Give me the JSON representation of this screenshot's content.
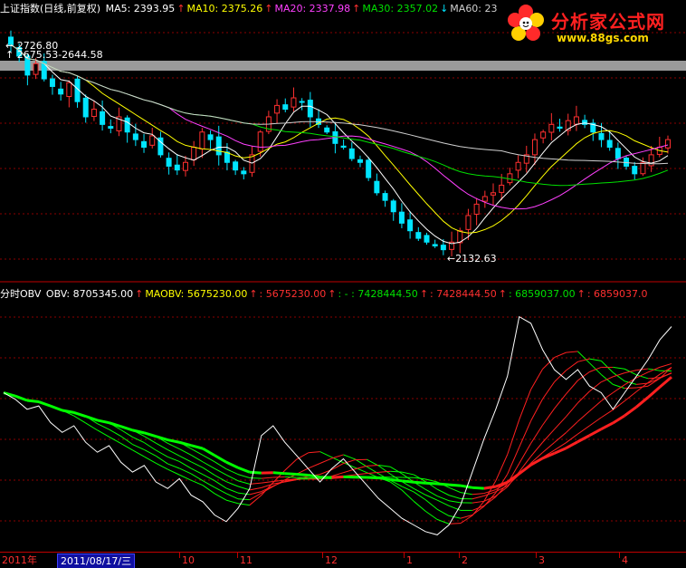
{
  "kline_header": {
    "title": "上证指数(日线,前复权)",
    "items": [
      {
        "label": "MA5: 2393.95",
        "arrow": "↑",
        "color": "#ffffff"
      },
      {
        "label": "MA10: 2375.26",
        "arrow": "↑",
        "color": "#ffff00"
      },
      {
        "label": "MA20: 2337.98",
        "arrow": "↑",
        "color": "#ff40ff"
      },
      {
        "label": "MA30: 2357.02",
        "arrow": "↓",
        "color": "#00e000"
      },
      {
        "label": "MA60: 23",
        "arrow": "",
        "color": "#d0d0d0"
      }
    ]
  },
  "obv_header": {
    "title": "分时OBV",
    "items": [
      {
        "label": "OBV: 8705345.00",
        "arrow": "↑",
        "color": "#ffffff"
      },
      {
        "label": "MAOBV: 5675230.00",
        "arrow": "↑",
        "color": "#ffff00"
      },
      {
        "label": ": 5675230.00",
        "arrow": "↑",
        "color": "#ff3030"
      },
      {
        "label": ": - : 7428444.50",
        "arrow": "↑",
        "color": "#00e000"
      },
      {
        "label": ": 7428444.50",
        "arrow": "↑",
        "color": "#ff3030"
      },
      {
        "label": ": 6859037.00",
        "arrow": "↑",
        "color": "#00e000"
      },
      {
        "label": ": 6859037.0",
        "arrow": "",
        "color": "#ff3030"
      }
    ]
  },
  "watermark": {
    "title": "分析家公式网",
    "url": "www.88gs.com"
  },
  "annotations": {
    "high_label": "2726.80",
    "range_label": "2675.53-2644.58",
    "low_label": "←2132.63"
  },
  "x_axis": {
    "year_label": "2011年",
    "selected_date": "2011/08/17/三",
    "months": [
      "10",
      "11",
      "12",
      "1",
      "2",
      "3",
      "4"
    ]
  },
  "colors": {
    "up": "#ff3030",
    "down": "#00e5ff",
    "ma5": "#ffffff",
    "ma10": "#ffff00",
    "ma20": "#ff40ff",
    "ma30": "#00e000",
    "ma60": "#d0d0d0",
    "obv": "#ffffff",
    "obv_green": "#00ff00",
    "obv_red": "#ff2020",
    "grid": "#8b0000"
  },
  "chart_data": [
    {
      "type": "candlestick",
      "title": "上证指数(日线,前复权)",
      "period": "2011-08 to 2012-04",
      "annotations": {
        "high": 2726.8,
        "low": 2132.63
      },
      "series": [
        {
          "name": "MA5",
          "last": 2393.95
        },
        {
          "name": "MA10",
          "last": 2375.26
        },
        {
          "name": "MA20",
          "last": 2337.98
        },
        {
          "name": "MA30",
          "last": 2357.02
        },
        {
          "name": "MA60"
        }
      ],
      "close_approx": [
        2690,
        2660,
        2610,
        2640,
        2600,
        2580,
        2560,
        2590,
        2540,
        2500,
        2520,
        2480,
        2470,
        2500,
        2460,
        2440,
        2420,
        2450,
        2400,
        2370,
        2360,
        2380,
        2420,
        2460,
        2440,
        2400,
        2380,
        2360,
        2350,
        2400,
        2460,
        2500,
        2530,
        2520,
        2550,
        2540,
        2500,
        2480,
        2460,
        2430,
        2420,
        2390,
        2380,
        2340,
        2300,
        2280,
        2250,
        2220,
        2200,
        2180,
        2170,
        2160,
        2150,
        2170,
        2200,
        2240,
        2270,
        2290,
        2300,
        2320,
        2350,
        2380,
        2400,
        2440,
        2460,
        2480,
        2470,
        2490,
        2500,
        2480,
        2460,
        2440,
        2420,
        2390,
        2370,
        2350,
        2380,
        2400,
        2420,
        2440
      ]
    },
    {
      "type": "line",
      "title": "分时OBV",
      "series": [
        {
          "name": "OBV",
          "last": 8705345.0
        },
        {
          "name": "MAOBV",
          "last": 5675230.0
        }
      ],
      "obv_approx": [
        5.9,
        5.7,
        5.4,
        5.5,
        5.0,
        4.7,
        4.9,
        4.4,
        4.1,
        4.3,
        3.8,
        3.5,
        3.7,
        3.2,
        3.0,
        3.3,
        2.8,
        2.6,
        2.2,
        2.0,
        2.4,
        3.0,
        4.6,
        4.9,
        4.4,
        4.0,
        3.6,
        3.2,
        3.6,
        3.9,
        3.5,
        3.1,
        2.7,
        2.4,
        2.1,
        1.9,
        1.7,
        1.6,
        1.9,
        2.5,
        3.5,
        4.5,
        5.4,
        6.4,
        8.2,
        8.0,
        7.2,
        6.6,
        6.3,
        6.6,
        6.1,
        5.9,
        5.4,
        5.9,
        6.4,
        6.9,
        7.5,
        7.9
      ]
    }
  ]
}
